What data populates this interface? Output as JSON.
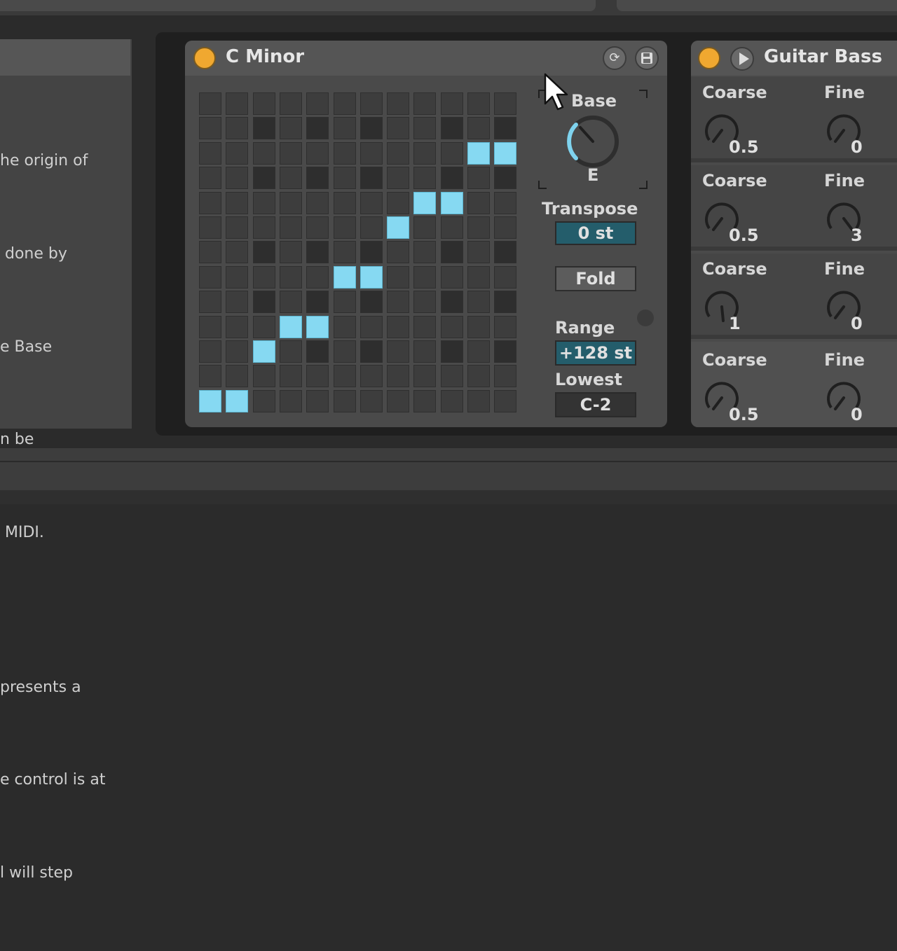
{
  "info_panel": {
    "lines": [
      "he origin of",
      " done by",
      "e Base",
      "n be",
      " MIDI.",
      "",
      "presents a",
      "e control is at",
      "l will step"
    ]
  },
  "scale_device": {
    "title": "C Minor",
    "buttons": {
      "hot_swap_icon": "hot-swap-icon",
      "save_icon": "save-icon"
    },
    "colors": {
      "power": "#f0a830",
      "active_cell": "#86d9f2",
      "value_highlight": "#245d6b"
    },
    "base": {
      "label": "Base",
      "value": "E"
    },
    "transpose": {
      "label": "Transpose",
      "value": "0 st"
    },
    "fold": {
      "label": "Fold"
    },
    "range": {
      "label": "Range",
      "value": "+128 st"
    },
    "lowest": {
      "label": "Lowest",
      "value": "C-2"
    },
    "grid": {
      "cols": 12,
      "rows": 13,
      "dark_columns": [
        2,
        4,
        6,
        9,
        11
      ],
      "dark_rows": [
        1,
        3,
        6,
        8,
        10
      ],
      "active": [
        [
          0,
          12
        ],
        [
          1,
          12
        ],
        [
          2,
          10
        ],
        [
          3,
          9
        ],
        [
          4,
          9
        ],
        [
          5,
          7
        ],
        [
          6,
          7
        ],
        [
          7,
          5
        ],
        [
          8,
          4
        ],
        [
          9,
          4
        ],
        [
          10,
          2
        ],
        [
          11,
          2
        ]
      ]
    }
  },
  "guitar_bass": {
    "title": "Guitar Bass",
    "rows": [
      {
        "coarse_label": "Coarse",
        "coarse": "0.5",
        "fine_label": "Fine",
        "fine": "0"
      },
      {
        "coarse_label": "Coarse",
        "coarse": "0.5",
        "fine_label": "Fine",
        "fine": "3"
      },
      {
        "coarse_label": "Coarse",
        "coarse": "1",
        "fine_label": "Fine",
        "fine": "0"
      },
      {
        "coarse_label": "Coarse",
        "coarse": "0.5",
        "fine_label": "Fine",
        "fine": "0"
      }
    ]
  }
}
